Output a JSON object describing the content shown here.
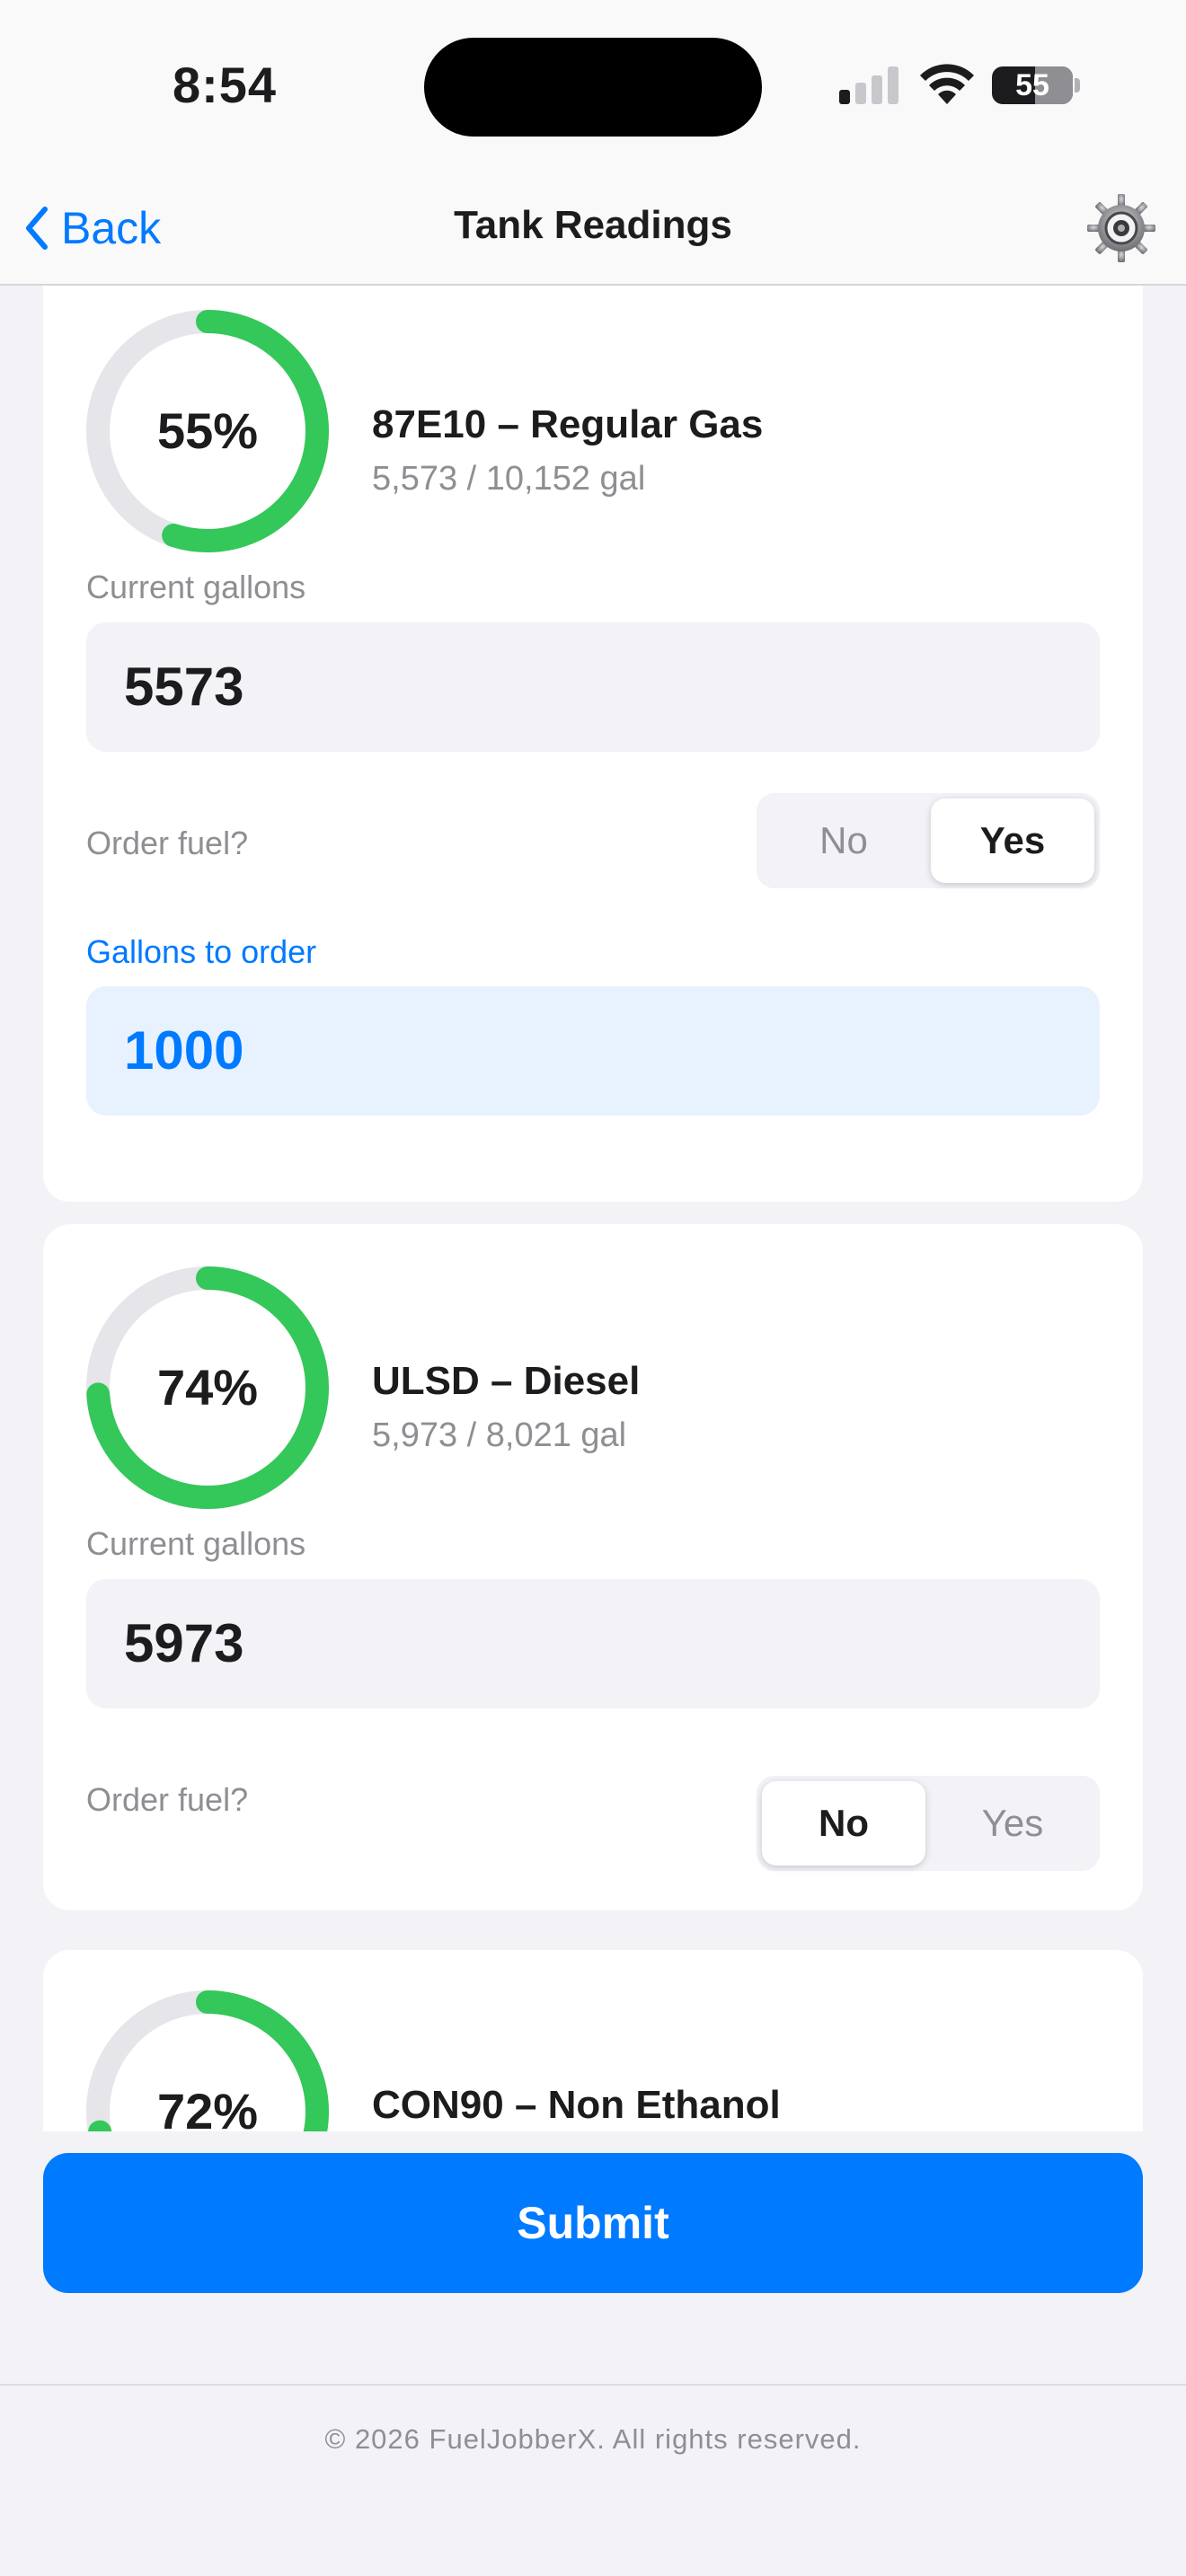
{
  "status_bar": {
    "time": "8:54",
    "battery": "55",
    "signal_icon": "cellular-signal-icon",
    "wifi_icon": "wifi-icon"
  },
  "nav": {
    "back_label": "Back",
    "title": "Tank Readings",
    "settings_icon": "gear-icon"
  },
  "labels": {
    "current_gallons": "Current gallons",
    "order_fuel": "Order fuel?",
    "gallons_to_order": "Gallons to order",
    "no": "No",
    "yes": "Yes"
  },
  "tanks": [
    {
      "percent_label": "55%",
      "percent": 55,
      "name": "87E10 – Regular Gas",
      "capacity": "5,573 / 10,152 gal",
      "current_gallons": "5573",
      "order_fuel": "Yes",
      "gallons_to_order": "1000"
    },
    {
      "percent_label": "74%",
      "percent": 74,
      "name": "ULSD – Diesel",
      "capacity": "5,973 / 8,021 gal",
      "current_gallons": "5973",
      "order_fuel": "No"
    },
    {
      "percent_label": "72%",
      "percent": 72,
      "name": "CON90 – Non Ethanol"
    }
  ],
  "submit_label": "Submit",
  "footer": "© 2026 FuelJobberX. All rights reserved.",
  "colors": {
    "accent": "#007aff",
    "ring_fill": "#34c759",
    "ring_track": "#e5e5ea"
  }
}
